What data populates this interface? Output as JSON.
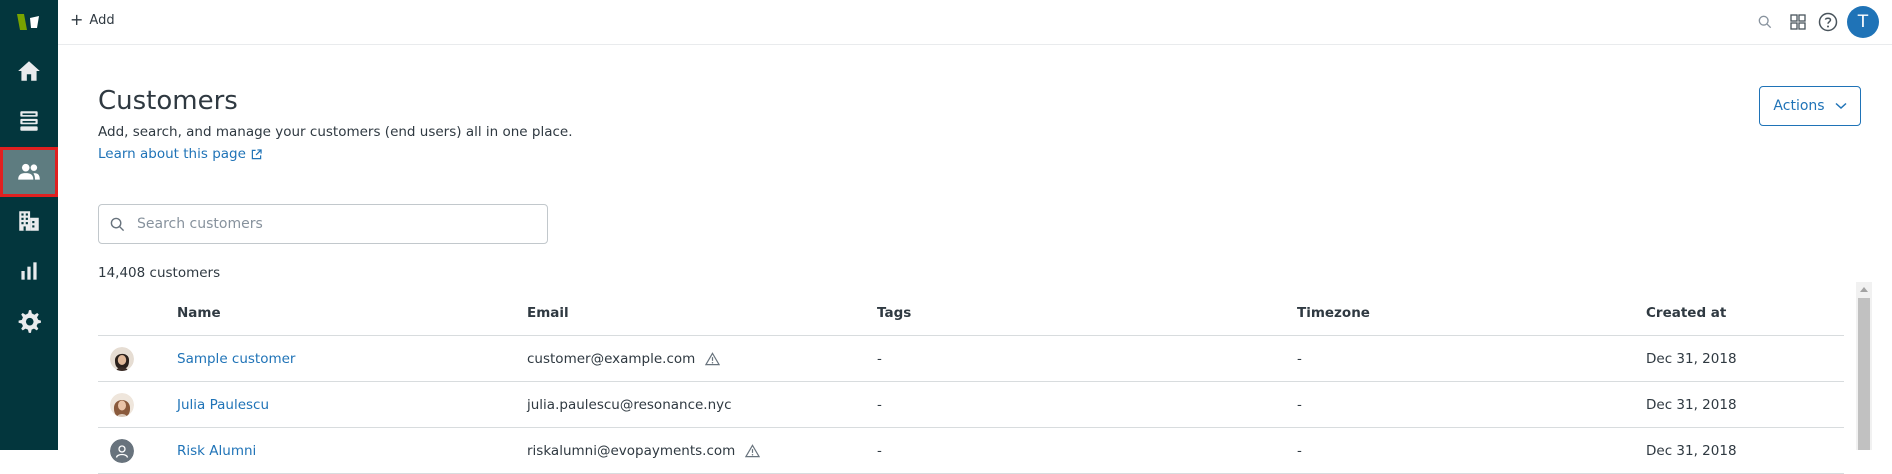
{
  "topbar": {
    "add_label": "Add"
  },
  "user": {
    "initial": "T"
  },
  "sidebar": {
    "items": [
      {
        "name": "home",
        "icon": "home-icon"
      },
      {
        "name": "views",
        "icon": "views-icon"
      },
      {
        "name": "customers",
        "icon": "customers-icon",
        "active": true
      },
      {
        "name": "organizations",
        "icon": "organizations-icon"
      },
      {
        "name": "reporting",
        "icon": "reporting-icon"
      },
      {
        "name": "admin",
        "icon": "gear-icon"
      }
    ]
  },
  "page": {
    "title": "Customers",
    "description": "Add, search, and manage your customers (end users) all in one place.",
    "learn_link": "Learn about this page",
    "actions_label": "Actions",
    "search_placeholder": "Search customers",
    "count": "14,408 customers"
  },
  "table": {
    "headers": {
      "name": "Name",
      "email": "Email",
      "tags": "Tags",
      "timezone": "Timezone",
      "created": "Created at"
    },
    "rows": [
      {
        "name": "Sample customer",
        "email": "customer@example.com",
        "warning": true,
        "tags": "-",
        "timezone": "-",
        "created": "Dec 31, 2018",
        "avatar": "photo-1"
      },
      {
        "name": "Julia Paulescu",
        "email": "julia.paulescu@resonance.nyc",
        "warning": false,
        "tags": "-",
        "timezone": "-",
        "created": "Dec 31, 2018",
        "avatar": "photo-2"
      },
      {
        "name": "Risk Alumni",
        "email": "riskalumni@evopayments.com",
        "warning": true,
        "tags": "-",
        "timezone": "-",
        "created": "Dec 31, 2018",
        "avatar": "default"
      }
    ]
  },
  "colors": {
    "sidebar_bg": "#03363d",
    "active_item": "#5e7c80",
    "highlight": "#e02020",
    "link": "#1f73b7",
    "avatar": "#1f73b7"
  }
}
